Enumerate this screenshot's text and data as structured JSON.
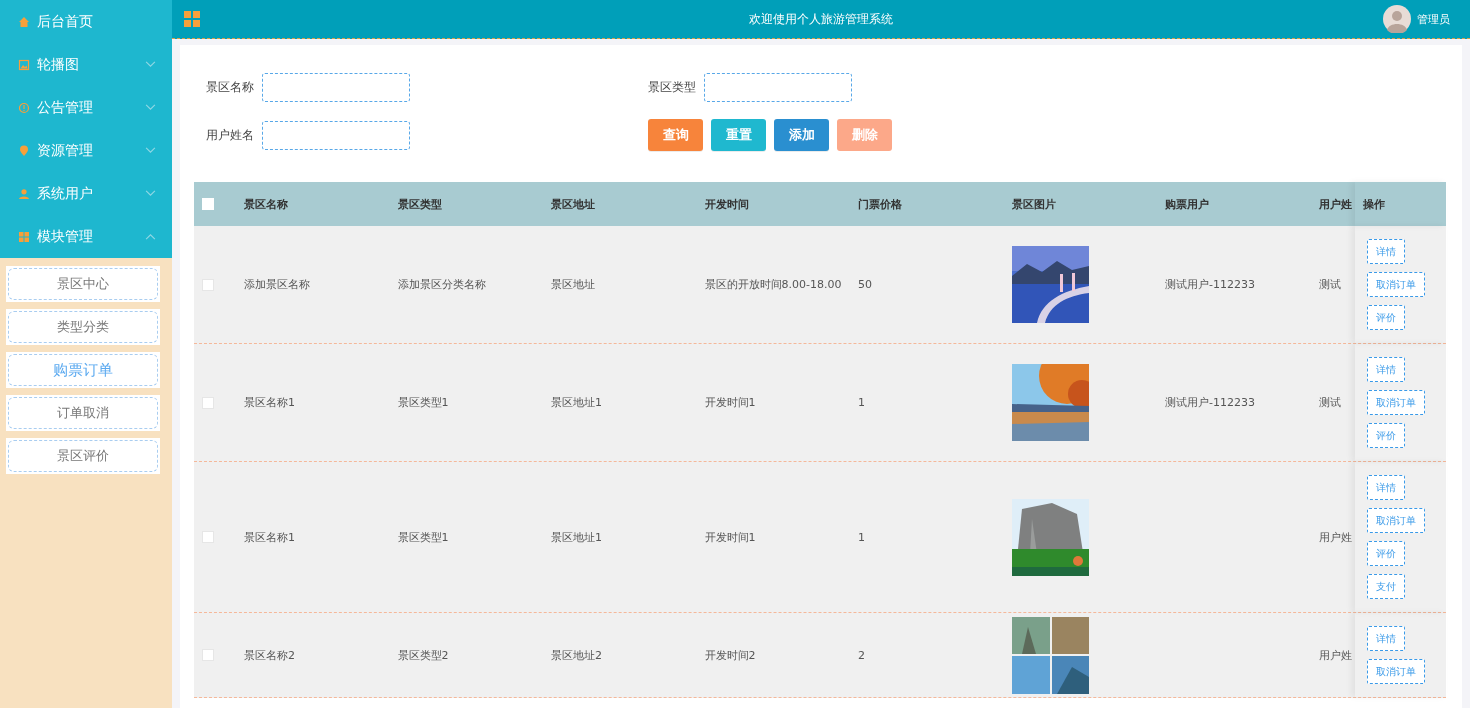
{
  "sidebar": {
    "items": [
      {
        "label": "后台首页"
      },
      {
        "label": "轮播图",
        "expanded": false
      },
      {
        "label": "公告管理",
        "expanded": false
      },
      {
        "label": "资源管理",
        "expanded": false
      },
      {
        "label": "系统用户",
        "expanded": false
      },
      {
        "label": "模块管理",
        "expanded": true,
        "children": [
          {
            "label": "景区中心",
            "selected": false
          },
          {
            "label": "类型分类",
            "selected": false
          },
          {
            "label": "购票订单",
            "selected": true
          },
          {
            "label": "订单取消",
            "selected": false
          },
          {
            "label": "景区评价",
            "selected": false
          }
        ]
      }
    ]
  },
  "header": {
    "title": "欢迎使用个人旅游管理系统",
    "user": "管理员"
  },
  "filters": [
    {
      "label": "景区名称"
    },
    {
      "label": "景区类型"
    },
    {
      "label": "用户姓名"
    }
  ],
  "buttons": [
    {
      "label": "查询",
      "color": "#f7843b",
      "disabled": false
    },
    {
      "label": "重置",
      "color": "#1fb8cf",
      "disabled": false
    },
    {
      "label": "添加",
      "color": "#2a8fd0",
      "disabled": false
    },
    {
      "label": "删除",
      "color": "#fca889",
      "disabled": true
    }
  ],
  "table": {
    "all_checked": false,
    "columns": [
      "景区名称",
      "景区类型",
      "景区地址",
      "开发时间",
      "门票价格",
      "景区图片",
      "购票用户",
      "用户姓",
      "操作"
    ],
    "rows": [
      {
        "checked": false,
        "cells": [
          "添加景区名称",
          "添加景区分类名称",
          "景区地址",
          "景区的开放时间8.00-18.00",
          "50"
        ],
        "image": {
          "kind": "picture"
        },
        "buyer": "测试用户-112233",
        "user_name": "测试",
        "actions": [
          "详情",
          "取消订单",
          "评价"
        ]
      },
      {
        "checked": false,
        "cells": [
          "景区名称1",
          "景区类型1",
          "景区地址1",
          "开发时间1",
          "1"
        ],
        "image": {
          "kind": "picture"
        },
        "buyer": "测试用户-112233",
        "user_name": "测试",
        "actions": [
          "详情",
          "取消订单",
          "评价"
        ]
      },
      {
        "checked": false,
        "cells": [
          "景区名称1",
          "景区类型1",
          "景区地址1",
          "开发时间1",
          "1"
        ],
        "image": {
          "kind": "picture"
        },
        "user_name": "用户姓",
        "actions": [
          "详情",
          "取消订单",
          "评价",
          "支付"
        ]
      },
      {
        "checked": false,
        "cells": [
          "景区名称2",
          "景区类型2",
          "景区地址2",
          "开发时间2",
          "2"
        ],
        "image": {
          "kind": "picture"
        },
        "user_name": "用户姓",
        "actions": [
          "详情",
          "取消订单"
        ]
      }
    ]
  }
}
